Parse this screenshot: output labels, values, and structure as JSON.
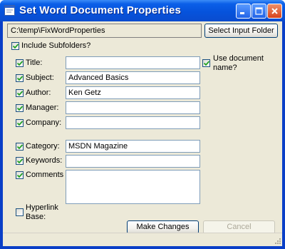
{
  "window": {
    "title": "Set Word Document Properties"
  },
  "folder": {
    "path": "C:\\temp\\FixWordProperties",
    "select_button_label": "Select Input Folder"
  },
  "include_subfolders": {
    "label": "Include Subfolders?",
    "checked": true
  },
  "use_document_name": {
    "label_line1": "Use document",
    "label_line2": "name?",
    "checked": true
  },
  "fields": {
    "title": {
      "label": "Title:",
      "checked": true,
      "value": ""
    },
    "subject": {
      "label": "Subject:",
      "checked": true,
      "value": "Advanced Basics"
    },
    "author": {
      "label": "Author:",
      "checked": true,
      "value": "Ken Getz"
    },
    "manager": {
      "label": "Manager:",
      "checked": true,
      "value": ""
    },
    "company": {
      "label": "Company:",
      "checked": true,
      "value": ""
    },
    "category": {
      "label": "Category:",
      "checked": true,
      "value": "MSDN Magazine"
    },
    "keywords": {
      "label": "Keywords:",
      "checked": true,
      "value": ""
    },
    "comments": {
      "label": "Comments",
      "checked": true,
      "value": ""
    },
    "hyperlink_base": {
      "label_line1": "Hyperlink",
      "label_line2": "Base:",
      "checked": false
    }
  },
  "buttons": {
    "make_changes": "Make Changes",
    "cancel": "Cancel"
  },
  "icons": {
    "window_icon": "form-icon",
    "minimize": "minimize-icon",
    "maximize": "maximize-icon",
    "close": "close-icon",
    "check": "check-icon",
    "grip": "resize-grip-icon"
  },
  "colors": {
    "titlebar": "#0653dc",
    "client": "#ece9d8",
    "check_mark": "#21a121",
    "textbox_border": "#7f9db9",
    "close_button": "#d7431b"
  }
}
